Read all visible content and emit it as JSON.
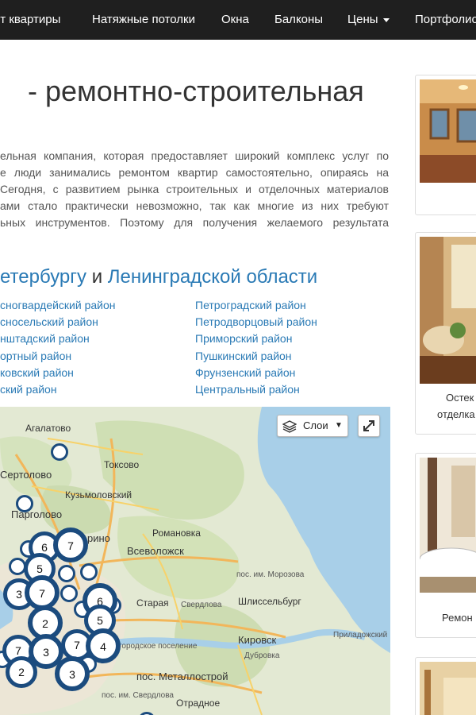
{
  "nav": {
    "items": [
      "нт квартиры",
      "Натяжные потолки",
      "Окна",
      "Балконы",
      "Цены",
      "Портфолио"
    ]
  },
  "main": {
    "title": "- ремонтно-строительная",
    "intro_lines": [
      "ельная компания, которая предоставляет широкий комплекс услуг по",
      "е люди занимались ремонтом квартир самостоятельно, опираясь на",
      "Сегодня, с развитием рынка строительных и отделочных материалов",
      "ами стало практически невозможно, так как многие из них требуют",
      "ьных инструментов. Поэтому для получения желаемого результата"
    ],
    "districts_heading": {
      "part1": "етербургу",
      "conj": "и",
      "part2": "Ленинградской области"
    },
    "districts_col1": [
      "сногвардейский район",
      "сносельский район",
      "нштадский район",
      "ортный район",
      "ковский район",
      "ский район"
    ],
    "districts_col2": [
      "Петроградский район",
      "Петродворцовый район",
      "Приморский район",
      "Пушкинский район",
      "Фрунзенский район",
      "Центральный район"
    ]
  },
  "map": {
    "layers_label": "Слои",
    "places": {
      "agalatovo": "Агалатово",
      "sertolovo": "Сертолово",
      "toksovo": "Токсово",
      "kuzmolovsky": "Кузьмоловский",
      "pargolovo": "Парголово",
      "murino": "рино",
      "romanovka": "Романовка",
      "vsevolozhsk": "Всеволожск",
      "morozova": "пос. им. Морозова",
      "staraya": "Старая",
      "sverdlova_small": "Свердлова",
      "shlisselburg": "Шлиссельбург",
      "kirovsk": "Кировск",
      "prilad": "Приладожский",
      "dubrovka": "Дубровка",
      "gorodskoe": "городское поселение",
      "metallostroy": "пос. Металлострой",
      "sverdlova": "пос. им. Свердлова",
      "otradnoe": "Отрадное"
    },
    "clusters": [
      "6",
      "7",
      "5",
      "3",
      "7",
      "6",
      "5",
      "2",
      "7",
      "4",
      "7",
      "3",
      "2",
      "3"
    ]
  },
  "sidebar": {
    "captions": [
      "Остек",
      "отделка",
      "Ремон"
    ]
  },
  "colors": {
    "navbar": "#1f1f1f",
    "link": "#2a7ab5",
    "cluster": "#1b4b7e"
  }
}
